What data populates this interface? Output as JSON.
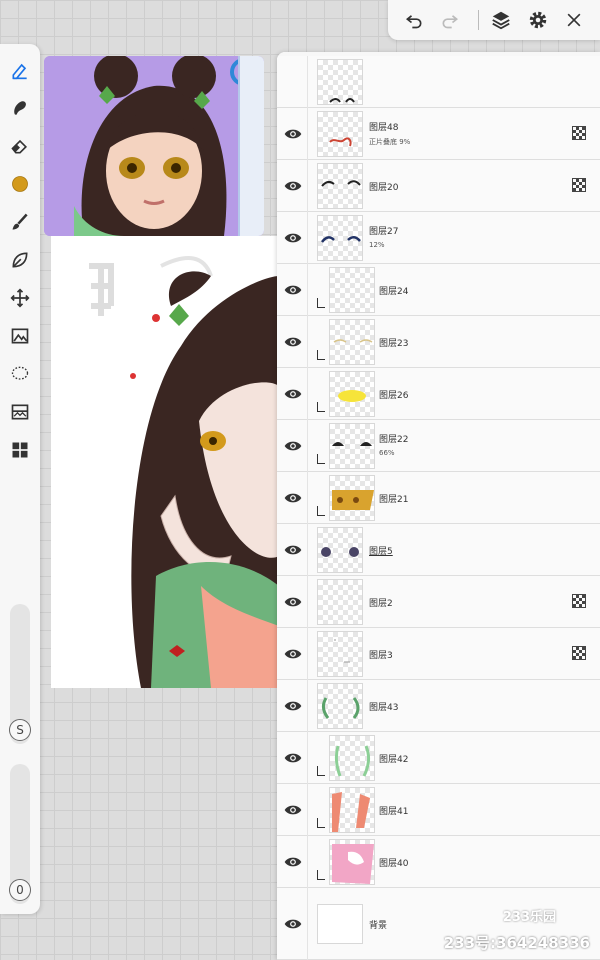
{
  "topbar": {
    "icons": [
      "undo-icon",
      "redo-icon",
      "layers-icon",
      "settings-icon",
      "close-icon"
    ]
  },
  "tools": {
    "icons": [
      "pen-icon",
      "smudge-icon",
      "eraser-icon",
      "color-swatch",
      "brush-icon",
      "leaf-icon",
      "move-icon",
      "image-icon",
      "lasso-icon",
      "filter-icon",
      "grid-icon"
    ],
    "current_color": "#d39a1c",
    "size_label": "S",
    "opacity_label": "0"
  },
  "layers_panel": {
    "header_icons": [
      "add-layer-icon",
      "folder-icon",
      "lock-icon",
      "merge-down-icon",
      "alpha-lock-icon",
      "pin-icon",
      "target-icon"
    ],
    "accent": "#1a73e8",
    "layers": [
      {
        "name": "图层48",
        "sub": "正片叠底  9%",
        "clip": false,
        "alpha": true,
        "thumb": "red"
      },
      {
        "name": "图层20",
        "sub": "",
        "clip": false,
        "alpha": true,
        "thumb": "brows"
      },
      {
        "name": "图层27",
        "sub": "12%",
        "clip": false,
        "alpha": false,
        "thumb": "navy"
      },
      {
        "name": "图层24",
        "sub": "",
        "clip": true,
        "alpha": false,
        "thumb": "empty"
      },
      {
        "name": "图层23",
        "sub": "",
        "clip": true,
        "alpha": false,
        "thumb": "lines"
      },
      {
        "name": "图层26",
        "sub": "",
        "clip": true,
        "alpha": false,
        "thumb": "yellow"
      },
      {
        "name": "图层22",
        "sub": "66%",
        "clip": true,
        "alpha": false,
        "thumb": "eyes"
      },
      {
        "name": "图层21",
        "sub": "",
        "clip": true,
        "alpha": false,
        "thumb": "gold"
      },
      {
        "name": "图层5",
        "sub": "",
        "clip": false,
        "alpha": false,
        "thumb": "dots"
      },
      {
        "name": "图层2",
        "sub": "",
        "clip": false,
        "alpha": true,
        "thumb": "empty"
      },
      {
        "name": "图层3",
        "sub": "",
        "clip": false,
        "alpha": true,
        "thumb": "faint"
      },
      {
        "name": "图层43",
        "sub": "",
        "clip": false,
        "alpha": false,
        "thumb": "green"
      },
      {
        "name": "图层42",
        "sub": "",
        "clip": true,
        "alpha": false,
        "thumb": "green2"
      },
      {
        "name": "图层41",
        "sub": "",
        "clip": true,
        "alpha": false,
        "thumb": "salmon"
      },
      {
        "name": "图层40",
        "sub": "",
        "clip": true,
        "alpha": false,
        "thumb": "pink"
      },
      {
        "name": "背景",
        "sub": "",
        "clip": false,
        "alpha": false,
        "thumb": "white"
      }
    ]
  },
  "watermark": {
    "site": "233乐园",
    "id": "233号:364248336"
  }
}
